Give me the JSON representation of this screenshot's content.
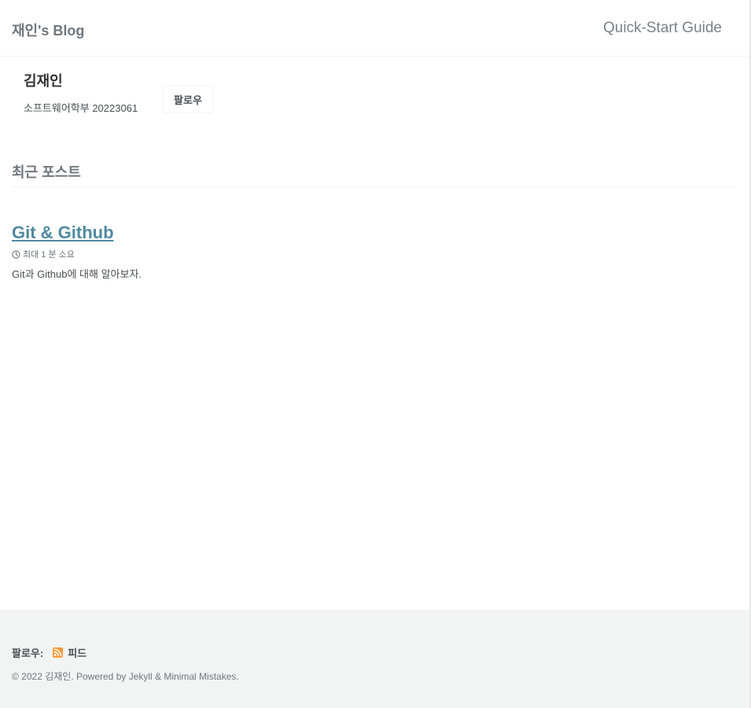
{
  "masthead": {
    "site_title": "재인's Blog",
    "nav_link": "Quick-Start Guide"
  },
  "author": {
    "name": "김재인",
    "bio": "소프트웨어학부 20223061",
    "follow_label": "팔로우"
  },
  "recent": {
    "section_title": "최근 포스트",
    "posts": [
      {
        "title": "Git & Github",
        "read_time": "최대 1 분 소요",
        "excerpt": "Git과 Github에 대해 알아보자."
      }
    ]
  },
  "footer": {
    "follow_label": "팔로우:",
    "feed_label": "피드",
    "copyright": "© 2022 김재인. Powered by Jekyll & Minimal Mistakes."
  },
  "colors": {
    "link": "#4f8aa0",
    "footer_bg": "#f2f3f3",
    "rss": "#fa9b39"
  },
  "icons": {
    "meta": "clock-icon",
    "feed": "rss-icon"
  }
}
